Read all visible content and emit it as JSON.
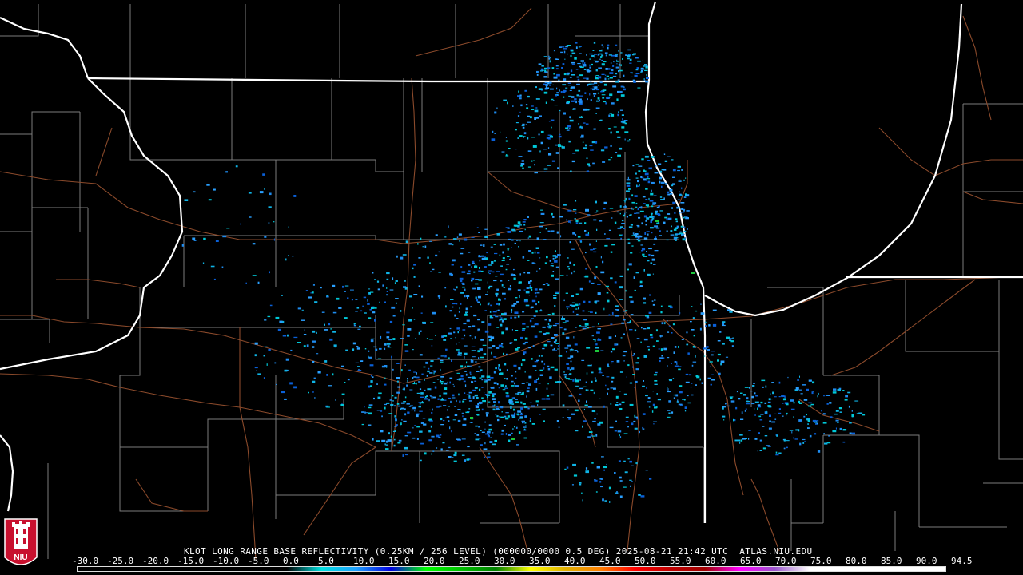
{
  "product": {
    "caption": "KLOT LONG RANGE BASE REFLECTIVITY (0.25KM / 256 LEVEL) (000000/0000 0.5 DEG) 2025-08-21 21:42 UTC  ATLAS.NIU.EDU"
  },
  "logo": {
    "text": "NIU",
    "colors": {
      "shield": "#c8102e",
      "tower": "#ffffff"
    }
  },
  "scale": {
    "labels": [
      "-30.0",
      "-25.0",
      "-20.0",
      "-15.0",
      "-10.0",
      "-5.0",
      "0.0",
      "5.0",
      "10.0",
      "15.0",
      "20.0",
      "25.0",
      "30.0",
      "35.0",
      "40.0",
      "45.0",
      "50.0",
      "55.0",
      "60.0",
      "65.0",
      "70.0",
      "75.0",
      "80.0",
      "85.0",
      "90.0",
      "94.5"
    ],
    "stops": [
      {
        "value": -30,
        "color": "#000000"
      },
      {
        "value": 0,
        "color": "#000000"
      },
      {
        "value": 5,
        "color": "#00e0e0"
      },
      {
        "value": 10,
        "color": "#1ea0ff"
      },
      {
        "value": 15,
        "color": "#0000e0"
      },
      {
        "value": 20,
        "color": "#00ff00"
      },
      {
        "value": 25,
        "color": "#00c000"
      },
      {
        "value": 30,
        "color": "#008000"
      },
      {
        "value": 35,
        "color": "#ffff00"
      },
      {
        "value": 40,
        "color": "#e0b000"
      },
      {
        "value": 45,
        "color": "#ff8000"
      },
      {
        "value": 50,
        "color": "#ff0000"
      },
      {
        "value": 55,
        "color": "#c00000"
      },
      {
        "value": 60,
        "color": "#a00000"
      },
      {
        "value": 65,
        "color": "#ff00ff"
      },
      {
        "value": 70,
        "color": "#9955cc"
      },
      {
        "value": 75,
        "color": "#ffffff"
      },
      {
        "value": 94.5,
        "color": "#ffffff"
      }
    ]
  },
  "map_style": {
    "background": "#000000",
    "state_border": "#ffffff",
    "county_border": "#8a8a8a",
    "road": "#8b4a2b"
  },
  "echo_colors": [
    "#0fb4e6",
    "#1e8cf0",
    "#0a60d8",
    "#00c8d8",
    "#2aa0ff"
  ],
  "echo_highlight": "#1ec83c"
}
